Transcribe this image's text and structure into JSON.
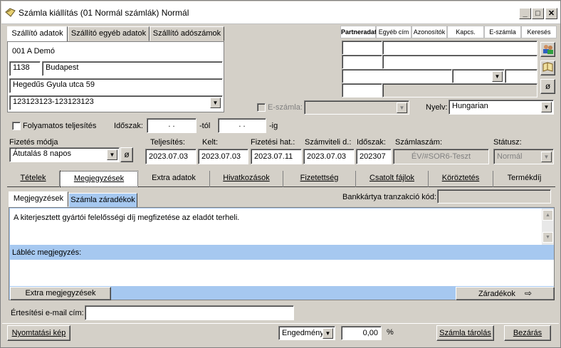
{
  "window": {
    "title": "Számla kiállítás (01 Normál számlák) Normál"
  },
  "supplier_tabs": [
    "Szállító adatok",
    "Szállító egyéb adatok",
    "Szállító adószámok"
  ],
  "supplier": {
    "name": "001 A Demó",
    "zip": "1138",
    "city": "Budapest",
    "street": "Hegedűs Gyula utca 59",
    "tax_number": "123123123-123123123"
  },
  "partner_tabs": [
    "Partneradat",
    "Egyéb cím",
    "Azonosítók",
    "Kapcs.",
    "E-számla",
    "Keresés"
  ],
  "einvoice": {
    "label": "E-számla:",
    "value": ""
  },
  "language": {
    "label": "Nyelv:",
    "value": "Hungarian"
  },
  "continuous": {
    "label": "Folyamatos teljesítés",
    "period_label": "Időszak:",
    "from_value": ". .",
    "from_suffix": "-tól",
    "to_value": ". .",
    "to_suffix": "-ig"
  },
  "fields": {
    "payment_method_label": "Fizetés módja",
    "payment_method": "Átutalás 8 napos",
    "fulfillment_label": "Teljesítés:",
    "fulfillment": "2023.07.03",
    "issued_label": "Kelt:",
    "issued": "2023.07.03",
    "due_label": "Fizetési hat.:",
    "due": "2023.07.11",
    "accounting_label": "Számviteli d.:",
    "accounting": "2023.07.03",
    "period_label": "Időszak:",
    "period": "202307",
    "invoice_no_label": "Számlaszám:",
    "invoice_no": "ÉV/#SOR6-Teszt",
    "status_label": "Státusz:",
    "status": "Normál"
  },
  "main_tabs": [
    "Tételek",
    "Megjegyzések",
    "Extra adatok",
    "Hivatkozások",
    "Fizetettség",
    "Csatolt fájlok",
    "Köröztetés",
    "Termékdíj"
  ],
  "sub_tabs": [
    "Megjegyzések",
    "Számla záradékok"
  ],
  "card_tx": {
    "label": "Bankkártya tranzakció kód:",
    "value": ""
  },
  "notes": {
    "text": "A kiterjesztett gyártói felelősségi díj megfizetése az eladót terheli.",
    "footer_label": "Lábléc megjegyzés:",
    "footer_text": ""
  },
  "buttons": {
    "extra_notes": "Extra megjegyzések",
    "clauses": "Záradékok",
    "print_preview": "Nyomtatási kép",
    "save_invoice": "Számla tárolás",
    "close": "Bezárás"
  },
  "email": {
    "label": "Értesítési e-mail cím:",
    "value": ""
  },
  "discount": {
    "type": "Engedmény",
    "value": "0,00",
    "unit": "%"
  }
}
